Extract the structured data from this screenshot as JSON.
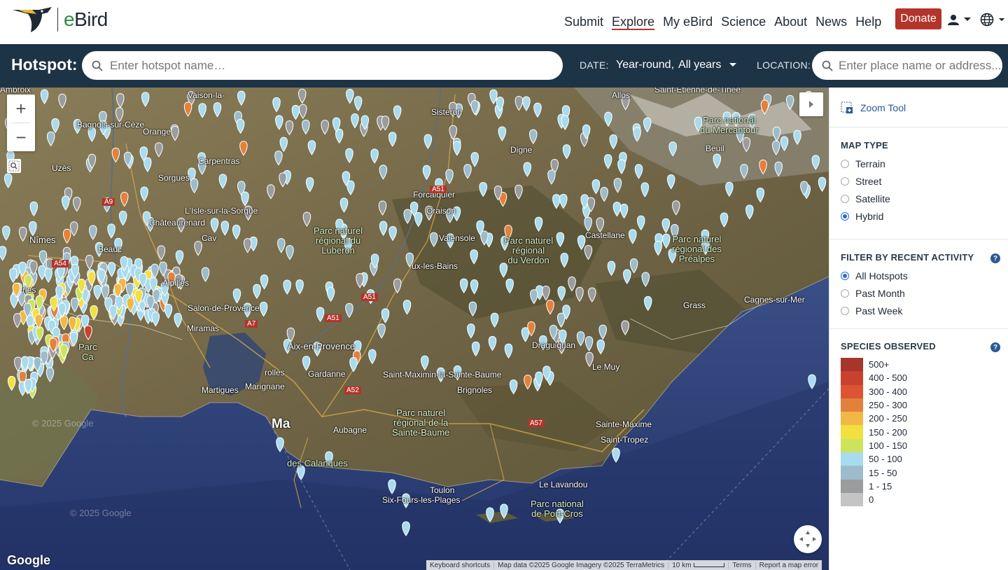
{
  "brand": {
    "name_e": "e",
    "name_rest": "Bird"
  },
  "nav": {
    "items": [
      "Submit",
      "Explore",
      "My eBird",
      "Science",
      "About",
      "News",
      "Help"
    ],
    "active": "Explore",
    "donate": "Donate"
  },
  "search": {
    "title": "Hotspot:",
    "placeholder": "Enter hotspot name…",
    "date_label": "DATE:",
    "date_season": "Year-round,",
    "date_years": "All years",
    "location_label": "LOCATION:",
    "location_placeholder": "Enter place name or address..."
  },
  "map": {
    "labels": {
      "ambroix": "Ambroix",
      "vaison": "Vaison-la-",
      "sisteron": "Sisteron",
      "allos": "Allos",
      "saint_etienne": "Saint-Etienne-de-Tinée",
      "bagnols": "Bagnols-sur-Cèze",
      "orange": "Orange",
      "digne": "Digne",
      "uzes": "Uzès",
      "carpentras": "Carpentras",
      "sorgues": "Sorgues",
      "forcalquier": "Forcalquier",
      "oraison": "Oraison",
      "isle": "L'Isle-sur-la-Sorgue",
      "chateaurenard": "Châteaurenard",
      "cavaillon": "Cav",
      "nimes": "Nîmes",
      "beaucaire": "Beauc",
      "valensole": "Valensole",
      "castellane": "Castellane",
      "manosque": "ux-les-Bains",
      "salon": "Salon-de-Provence",
      "miramas": "Miramas",
      "aix": "Aix-en-Provence",
      "grasse": "Grass",
      "cagnes": "Cagnes-sur-Mer",
      "draguignan": "Draguignan",
      "le_muy": "Le Muy",
      "gardanne": "Gardanne",
      "maximin": "Saint-Maximin-la-Sainte-Baume",
      "brignoles": "Brignoles",
      "rolles": "rolles",
      "martigues": "Martigues",
      "marignane": "Marignane",
      "marseille": "Ma",
      "aubagne": "Aubagne",
      "sainte_maxime": "Sainte-Maxime",
      "saint_tropez": "Saint-Tropez",
      "toulon": "Toulon",
      "six_fours": "Six-Fours-les-Plages",
      "lavandou": "Le Lavandou",
      "beuil": "Beuil",
      "arles": "rles",
      "park_luberon": "Parc naturel\nrégional du\nLuberon",
      "park_verdon": "Parc naturel\nrégional\ndu Verdon",
      "park_mercantour": "Parc national\ndu Mercantour",
      "park_prealpes": "Parc naturel\nrégional des\nPréalpes",
      "park_baume": "Parc naturel\nrégional de la\nSainte-Baume",
      "park_calanques": "des Calanques",
      "park_portcros": "Parc national\nde Port-Cros",
      "park_camargue": "Parc\nCa",
      "alpilles": "Alpilles",
      "a51": "A51",
      "a9": "A9",
      "a7": "A7",
      "a54": "A54",
      "a52": "A52",
      "a57": "A57",
      "a51b": "A51",
      "a51c": "A51",
      "watermark1": "© 2025 Google",
      "watermark2": "© 2025 Google"
    },
    "google": "Google",
    "attribution": {
      "shortcuts": "Keyboard shortcuts",
      "data": "Map data ©2025 Google Imagery ©2025 TerraMetrics",
      "scale": "10 km",
      "terms": "Terms",
      "report": "Report a map error"
    }
  },
  "sidebar": {
    "zoom_tool": "Zoom Tool",
    "map_type": {
      "title": "MAP TYPE",
      "options": [
        "Terrain",
        "Street",
        "Satellite",
        "Hybrid"
      ],
      "selected": "Hybrid"
    },
    "filter": {
      "title": "FILTER BY RECENT ACTIVITY",
      "options": [
        "All Hotspots",
        "Past Month",
        "Past Week"
      ],
      "selected": "All Hotspots"
    },
    "species": {
      "title": "SPECIES OBSERVED",
      "legend": [
        {
          "label": "500+",
          "color": "#a8352b"
        },
        {
          "label": "400 - 500",
          "color": "#c6422f"
        },
        {
          "label": "300 - 400",
          "color": "#dc5433"
        },
        {
          "label": "250 - 300",
          "color": "#e3813c"
        },
        {
          "label": "200 - 250",
          "color": "#f2b845"
        },
        {
          "label": "150 - 200",
          "color": "#f2e041"
        },
        {
          "label": "100 - 150",
          "color": "#cde35e"
        },
        {
          "label": "50 - 100",
          "color": "#a9dbee"
        },
        {
          "label": "15 - 50",
          "color": "#9cbccb"
        },
        {
          "label": "1 - 15",
          "color": "#9a9c9e"
        },
        {
          "label": "0",
          "color": "#c4c4c4"
        }
      ]
    }
  }
}
